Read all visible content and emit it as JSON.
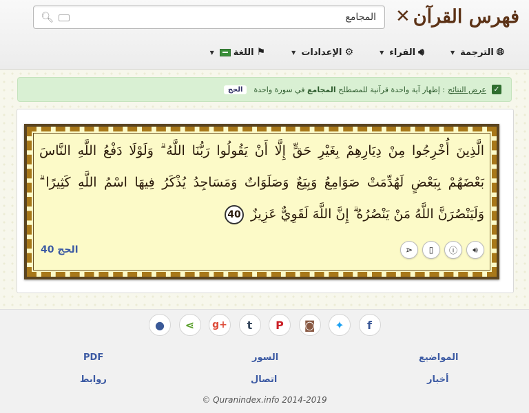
{
  "header": {
    "logo_text": "فهرس القرآن",
    "search": {
      "value": "المجامع",
      "placeholder": ""
    }
  },
  "nav": [
    {
      "label": "الترجمة",
      "icon": "globe-icon"
    },
    {
      "label": "القراء",
      "icon": "speaker-icon"
    },
    {
      "label": "الإعدادات",
      "icon": "gear-icon"
    },
    {
      "label": "اللغة",
      "icon": "flag-icon"
    }
  ],
  "alert": {
    "label": "عرض النتائج",
    "text_before": " : إظهار آية واحدة قرآنية للمصطلح",
    "term": "المجامع",
    "text_after": "في سورة واحدة",
    "tag": "الحج"
  },
  "verse": {
    "text": "الَّذِينَ أُخْرِجُوا مِنْ دِيَارِهِمْ بِغَيْرِ حَقٍّ إِلَّا أَنْ يَقُولُوا رَبُّنَا اللَّهُ ۗ وَلَوْلَا دَفْعُ اللَّهِ النَّاسَ بَعْضَهُمْ بِبَعْضٍ لَهُدِّمَتْ صَوَامِعُ وَبِيَعٌ وَصَلَوَاتٌ وَمَسَاجِدُ يُذْكَرُ فِيهَا اسْمُ اللَّهِ كَثِيرًا ۗ وَلَيَنْصُرَنَّ اللَّهُ مَنْ يَنْصُرُهُ ۗ إِنَّ اللَّهَ لَقَوِيٌّ عَزِيزٌ",
    "number": "40",
    "reference": "الحج 40"
  },
  "footer": {
    "social": [
      "facebook-icon",
      "twitter-icon",
      "instagram-icon",
      "pinterest-icon",
      "tumblr-icon",
      "google-plus-icon",
      "share-icon",
      "github-icon"
    ],
    "links": {
      "topics": "المواضيع",
      "surahs": "السور",
      "pdf": "PDF",
      "news": "أخبار",
      "contact": "اتصال",
      "links": "روابط"
    },
    "copyright": "© Quranindex.info 2014-2019"
  },
  "colors": {
    "accent": "#3c5aa3",
    "logo": "#5c3216",
    "alert_bg": "#d9f0d3",
    "frame_bg": "#fcfac8"
  }
}
